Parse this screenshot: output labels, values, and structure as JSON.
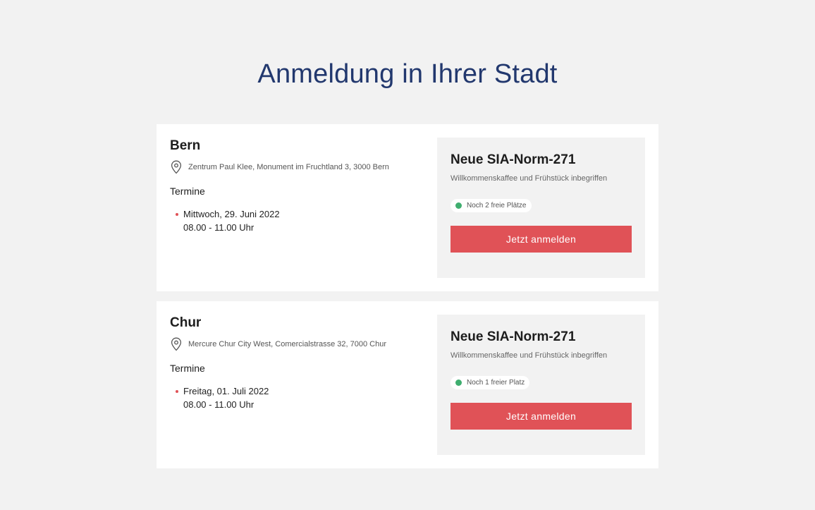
{
  "page": {
    "title": "Anmeldung in Ihrer Stadt"
  },
  "colors": {
    "background": "#f2f2f2",
    "title": "#22386e",
    "accent": "#e05257",
    "available": "#3fae6f"
  },
  "events": [
    {
      "city": "Bern",
      "address_icon": "location-pin-icon",
      "address": "Zentrum Paul Klee, Monument im Fruchtland 3, 3000 Bern",
      "termine_label": "Termine",
      "dates": [
        {
          "date": "Mittwoch, 29. Juni 2022",
          "time": "08.00 - 11.00 Uhr"
        }
      ],
      "course_title": "Neue SIA-Norm-271",
      "course_subtitle": "Willkommenskaffee und Frühstück inbegriffen",
      "availability": "Noch 2 freie Plätze",
      "button_label": "Jetzt anmelden"
    },
    {
      "city": "Chur",
      "address_icon": "location-pin-icon",
      "address": "Mercure Chur City West, Comercialstrasse 32, 7000 Chur",
      "termine_label": "Termine",
      "dates": [
        {
          "date": "Freitag, 01. Juli 2022",
          "time": "08.00 - 11.00 Uhr"
        }
      ],
      "course_title": "Neue SIA-Norm-271",
      "course_subtitle": "Willkommenskaffee und Frühstück inbegriffen",
      "availability": "Noch 1 freier Platz",
      "button_label": "Jetzt anmelden"
    }
  ]
}
